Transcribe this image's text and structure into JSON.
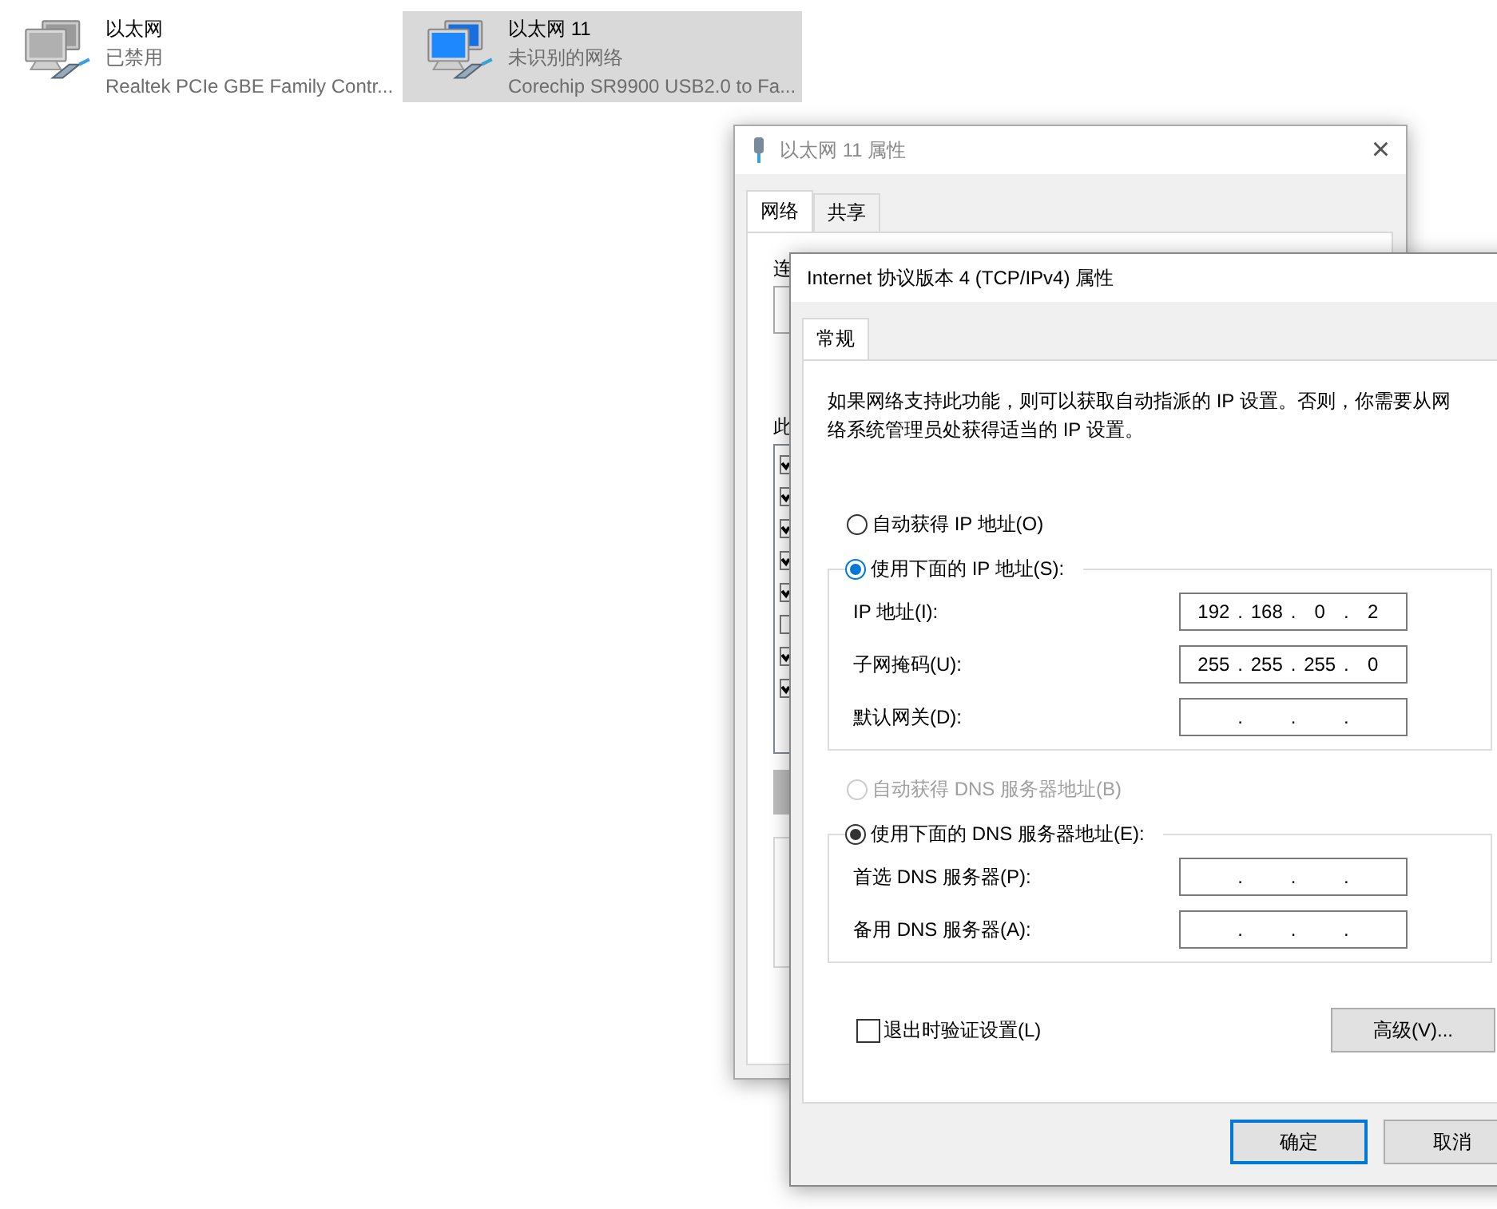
{
  "adapters": [
    {
      "name": "以太网",
      "status": "已禁用",
      "device": "Realtek PCIe GBE Family Contr...",
      "selected": false,
      "enabled": false
    },
    {
      "name": "以太网 11",
      "status": "未识别的网络",
      "device": "Corechip SR9900 USB2.0 to Fa...",
      "selected": true,
      "enabled": true
    }
  ],
  "back_window": {
    "title": "以太网 11 属性",
    "close": "×",
    "tabs": [
      {
        "label": "网络",
        "selected": true
      },
      {
        "label": "共享",
        "selected": false
      }
    ],
    "connect_label": "连",
    "items_label": "此",
    "components": [
      {
        "checked": true
      },
      {
        "checked": true
      },
      {
        "checked": true
      },
      {
        "checked": true
      },
      {
        "checked": true
      },
      {
        "checked": false
      },
      {
        "checked": true
      },
      {
        "checked": true
      }
    ]
  },
  "dialog": {
    "title": "Internet 协议版本 4 (TCP/IPv4) 属性",
    "tabs": [
      {
        "label": "常规",
        "selected": true
      }
    ],
    "description": "如果网络支持此功能，则可以获取自动指派的 IP 设置。否则，你需要从网络系统管理员处获得适当的 IP 设置。",
    "ip_options": [
      {
        "label": "自动获得 IP 地址(O)",
        "selected": false,
        "disabled": false
      },
      {
        "label": "使用下面的 IP 地址(S):",
        "selected": true,
        "disabled": false
      }
    ],
    "ip_fields": [
      {
        "label": "IP 地址(I):",
        "separator": ".",
        "octets": [
          "192",
          "168",
          "0",
          "2"
        ]
      },
      {
        "label": "子网掩码(U):",
        "separator": ".",
        "octets": [
          "255",
          "255",
          "255",
          "0"
        ]
      },
      {
        "label": "默认网关(D):",
        "separator": "."
      }
    ],
    "dns_options": [
      {
        "label": "自动获得 DNS 服务器地址(B)",
        "selected": false,
        "disabled": true
      },
      {
        "label": "使用下面的 DNS 服务器地址(E):",
        "selected": true,
        "disabled": false
      }
    ],
    "dns_fields": [
      {
        "label": "首选 DNS 服务器(P):",
        "separator": "."
      },
      {
        "label": "备用 DNS 服务器(A):",
        "separator": "."
      }
    ],
    "validate": {
      "label": "退出时验证设置(L)",
      "checked": false
    },
    "advanced_button": "高级(V)...",
    "buttons": [
      {
        "label": "确定",
        "default": true
      },
      {
        "label": "取消",
        "default": false
      }
    ]
  }
}
